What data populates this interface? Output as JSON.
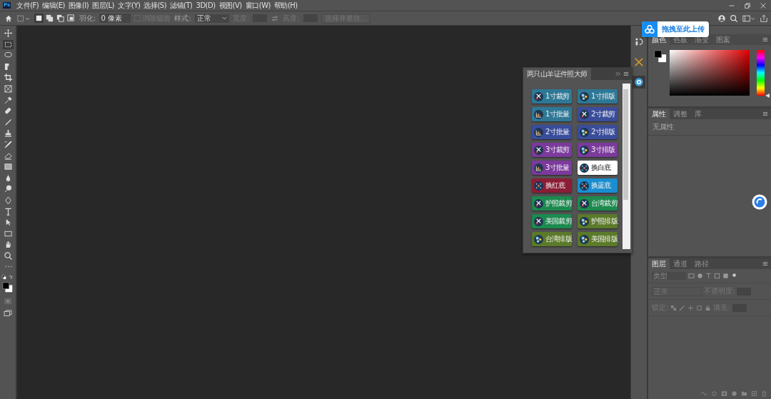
{
  "app_logo": "Ps",
  "menu": [
    "文件(F)",
    "编辑(E)",
    "图像(I)",
    "图层(L)",
    "文字(Y)",
    "选择(S)",
    "滤镜(T)",
    "3D(D)",
    "视图(V)",
    "窗口(W)",
    "帮助(H)"
  ],
  "options_bar": {
    "selection_modes": [
      {
        "selected": true
      },
      {
        "selected": false
      },
      {
        "selected": false
      },
      {
        "selected": false
      }
    ],
    "feather_label": "羽化:",
    "feather_value": "0 像素",
    "antialias": {
      "label": "消除锯齿",
      "checked": false,
      "disabled": true
    },
    "style_label": "样式:",
    "style_value": "正常",
    "width_label": "宽度:",
    "height_label": "高度:",
    "select_mask_button": "选择并遮住..."
  },
  "tools": [
    {
      "kind": "move",
      "selected": false
    },
    {
      "kind": "marquee",
      "selected": true
    },
    {
      "kind": "lasso",
      "selected": false
    },
    {
      "kind": "quick-select",
      "selected": false
    },
    {
      "kind": "crop",
      "selected": false
    },
    {
      "kind": "frame",
      "selected": false
    },
    {
      "kind": "eyedropper",
      "selected": false
    },
    {
      "kind": "healing",
      "selected": false
    },
    {
      "kind": "brush",
      "selected": false
    },
    {
      "kind": "stamp",
      "selected": false
    },
    {
      "kind": "history-brush",
      "selected": false
    },
    {
      "kind": "eraser",
      "selected": false
    },
    {
      "kind": "gradient",
      "selected": false
    },
    {
      "kind": "blur",
      "selected": false
    },
    {
      "kind": "dodge",
      "selected": false
    },
    {
      "kind": "pen",
      "selected": false
    },
    {
      "kind": "type",
      "selected": false
    },
    {
      "kind": "path-select",
      "selected": false
    },
    {
      "kind": "rectangle",
      "selected": false
    },
    {
      "kind": "hand",
      "selected": false
    },
    {
      "kind": "zoom",
      "selected": false
    },
    {
      "kind": "more",
      "selected": false
    }
  ],
  "upload_bubble": {
    "label": "拖拽至此上传"
  },
  "plugin_panel": {
    "title": "两只山羊证件照大师",
    "buttons": [
      {
        "label": "1寸裁剪",
        "kind": "scissors",
        "color": "#2e7896"
      },
      {
        "label": "1寸排版",
        "kind": "dots",
        "color": "#2e7896"
      },
      {
        "label": "1寸批量",
        "kind": "chart",
        "color": "#2e7896"
      },
      {
        "label": "2寸裁剪",
        "kind": "scissors",
        "color": "#3a4d9b"
      },
      {
        "label": "2寸批量",
        "kind": "chart",
        "color": "#3a4d9b"
      },
      {
        "label": "2寸排版",
        "kind": "dots",
        "color": "#3a4d9b"
      },
      {
        "label": "3寸裁剪",
        "kind": "scissors",
        "color": "#7b3a9c"
      },
      {
        "label": "3寸排版",
        "kind": "dots",
        "color": "#7b3a9c"
      },
      {
        "label": "3寸批量",
        "kind": "chart",
        "color": "#7b3a9c"
      },
      {
        "label": "换白底",
        "kind": "network",
        "color": "#ffffff"
      },
      {
        "label": "换红底",
        "kind": "network",
        "color": "#8b1d36"
      },
      {
        "label": "换蓝底",
        "kind": "network",
        "color": "#1a8ed0"
      },
      {
        "label": "护照裁剪",
        "kind": "scissors",
        "color": "#1c8a4f"
      },
      {
        "label": "台湾裁剪",
        "kind": "scissors",
        "color": "#1c8a4f"
      },
      {
        "label": "美国裁剪",
        "kind": "scissors",
        "color": "#1c8a4f"
      },
      {
        "label": "护照排版",
        "kind": "dots",
        "color": "#5b7a2a"
      },
      {
        "label": "台湾排版",
        "kind": "dots",
        "color": "#5b7a2a"
      },
      {
        "label": "美国排版",
        "kind": "dots",
        "color": "#5b7a2a"
      }
    ]
  },
  "color_panel": {
    "hue_slider": {
      "level": 0
    },
    "tabs": [
      {
        "label": "颜色",
        "selected": true
      },
      {
        "label": "色板",
        "selected": false
      },
      {
        "label": "渐变",
        "selected": false
      },
      {
        "label": "图案",
        "selected": false
      }
    ]
  },
  "properties_panel": {
    "tabs": [
      {
        "label": "属性",
        "selected": true
      },
      {
        "label": "调整",
        "selected": false
      },
      {
        "label": "库",
        "selected": false
      }
    ],
    "message": "无属性"
  },
  "layers_panel": {
    "tabs": [
      {
        "label": "图层",
        "selected": true
      },
      {
        "label": "通道",
        "selected": false
      },
      {
        "label": "路径",
        "selected": false
      }
    ],
    "filter_placeholder": "类型",
    "blend_mode": "正常",
    "opacity_label": "不透明度:",
    "lock_label": "锁定:",
    "fill_label": "填充:"
  }
}
